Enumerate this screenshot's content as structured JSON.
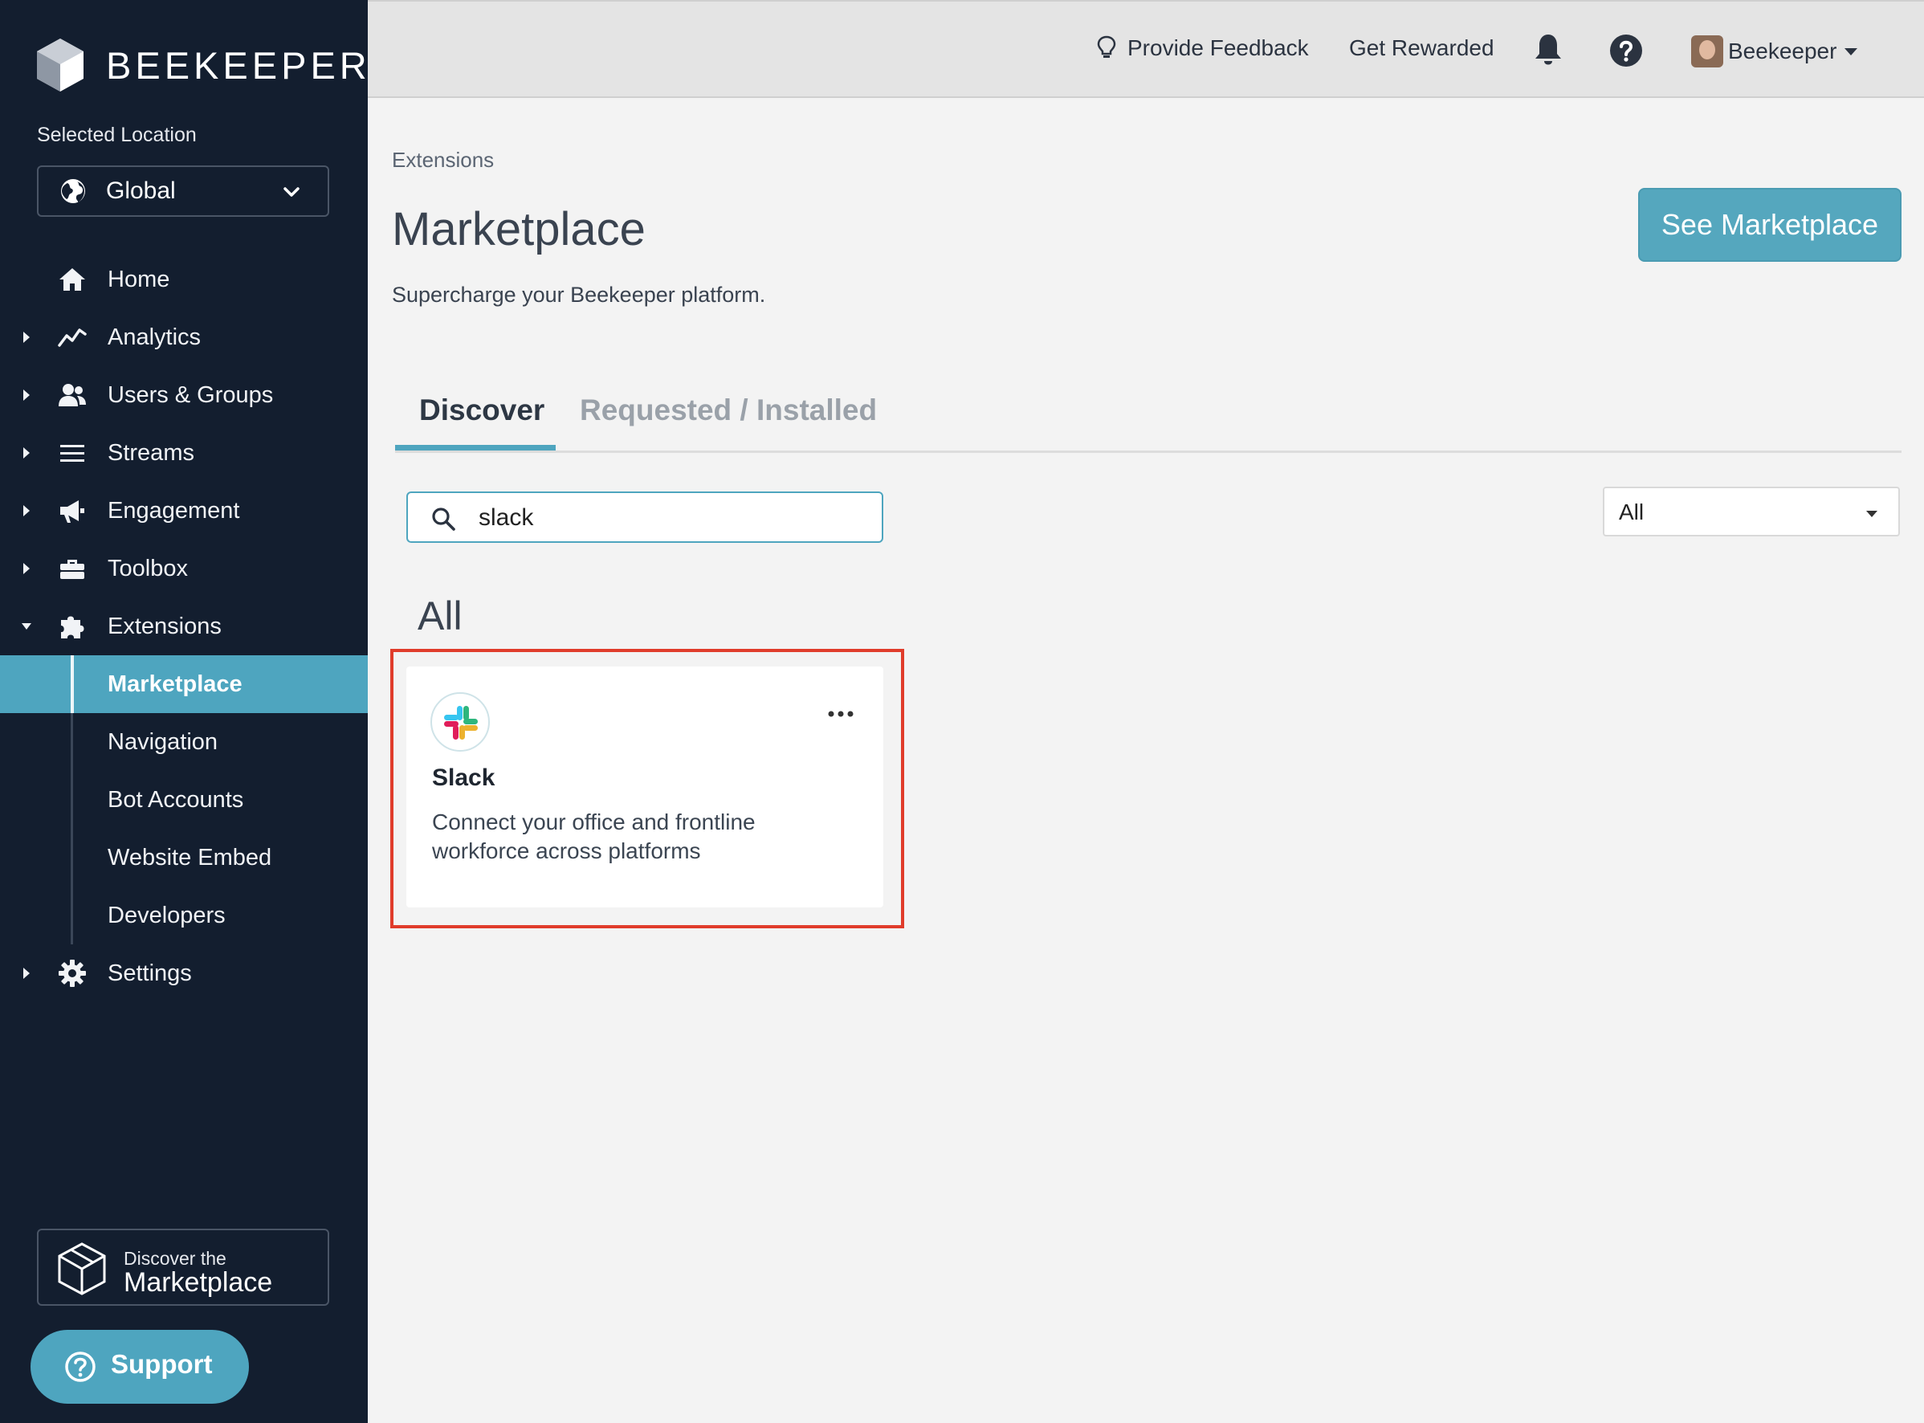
{
  "brand": {
    "name": "BEEKEEPER"
  },
  "location": {
    "label": "Selected Location",
    "value": "Global"
  },
  "nav": {
    "items": [
      {
        "label": "Home",
        "icon": "home-icon",
        "expandable": false
      },
      {
        "label": "Analytics",
        "icon": "analytics-icon",
        "expandable": true
      },
      {
        "label": "Users & Groups",
        "icon": "users-icon",
        "expandable": true
      },
      {
        "label": "Streams",
        "icon": "streams-icon",
        "expandable": true
      },
      {
        "label": "Engagement",
        "icon": "megaphone-icon",
        "expandable": true
      },
      {
        "label": "Toolbox",
        "icon": "toolbox-icon",
        "expandable": true
      },
      {
        "label": "Extensions",
        "icon": "puzzle-icon",
        "expandable": true,
        "expanded": true
      }
    ],
    "extensions_sub": [
      {
        "label": "Marketplace",
        "active": true
      },
      {
        "label": "Navigation"
      },
      {
        "label": "Bot Accounts"
      },
      {
        "label": "Website Embed"
      },
      {
        "label": "Developers"
      }
    ],
    "settings": {
      "label": "Settings",
      "icon": "gear-icon"
    }
  },
  "discover_marketplace": {
    "line1": "Discover the",
    "line2": "Marketplace"
  },
  "support": {
    "label": "Support"
  },
  "topbar": {
    "feedback": "Provide Feedback",
    "rewarded": "Get Rewarded",
    "user": "Beekeeper"
  },
  "main": {
    "breadcrumb": "Extensions",
    "title": "Marketplace",
    "subtitle": "Supercharge your Beekeeper platform.",
    "see_marketplace": "See Marketplace",
    "tabs": [
      {
        "label": "Discover",
        "active": true
      },
      {
        "label": "Requested / Installed",
        "active": false
      }
    ],
    "search": {
      "value": "slack",
      "placeholder": ""
    },
    "filter": {
      "value": "All"
    },
    "section_label": "All",
    "card": {
      "name": "Slack",
      "description": "Connect your office and frontline workforce across platforms"
    }
  },
  "colors": {
    "sidebar_bg": "#131e2f",
    "accent": "#4ea5bf",
    "highlight": "#e03c2b"
  }
}
